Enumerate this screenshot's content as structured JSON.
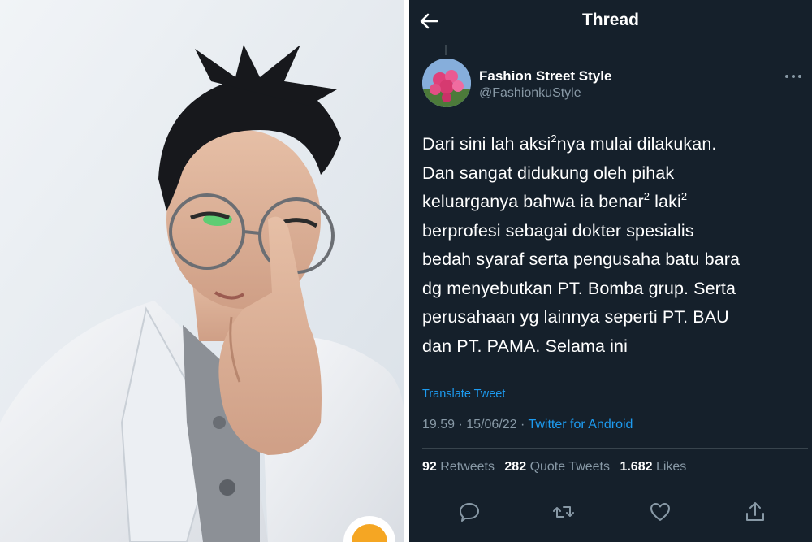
{
  "thread": {
    "title": "Thread",
    "back_icon": "arrow-left-icon",
    "author": {
      "name": "Fashion Street Style",
      "handle": "@FashionkuStyle"
    },
    "more_icon": "more-horizontal-icon",
    "text_lines": [
      [
        "Dari sini lah aksi",
        "2",
        "nya mulai dilakukan."
      ],
      [
        "Dan sangat didukung oleh pihak"
      ],
      [
        "keluarganya bahwa ia benar",
        "2",
        " laki",
        "2"
      ],
      [
        "berprofesi sebagai dokter spesialis"
      ],
      [
        "bedah syaraf serta pengusaha batu bara"
      ],
      [
        "dg menyebutkan PT. Bomba grup. Serta"
      ],
      [
        "perusahaan yg lainnya seperti PT. BAU"
      ],
      [
        "dan PT. PAMA. Selama ini"
      ]
    ],
    "translate": "Translate Tweet",
    "meta": {
      "time_date": "19.59 · 15/06/22 · ",
      "source": "Twitter for Android"
    },
    "stats": {
      "retweets_count": "92",
      "retweets_label": "Retweets",
      "quotes_count": "282",
      "quotes_label": "Quote Tweets",
      "likes_count": "1.682",
      "likes_label": "Likes"
    },
    "actions": [
      "reply-icon",
      "retweet-icon",
      "like-icon",
      "share-icon"
    ]
  },
  "colors": {
    "background": "#15202b",
    "text": "#ffffff",
    "secondary": "#8899a6",
    "accent": "#1d9bf0",
    "divider": "#38444d"
  }
}
